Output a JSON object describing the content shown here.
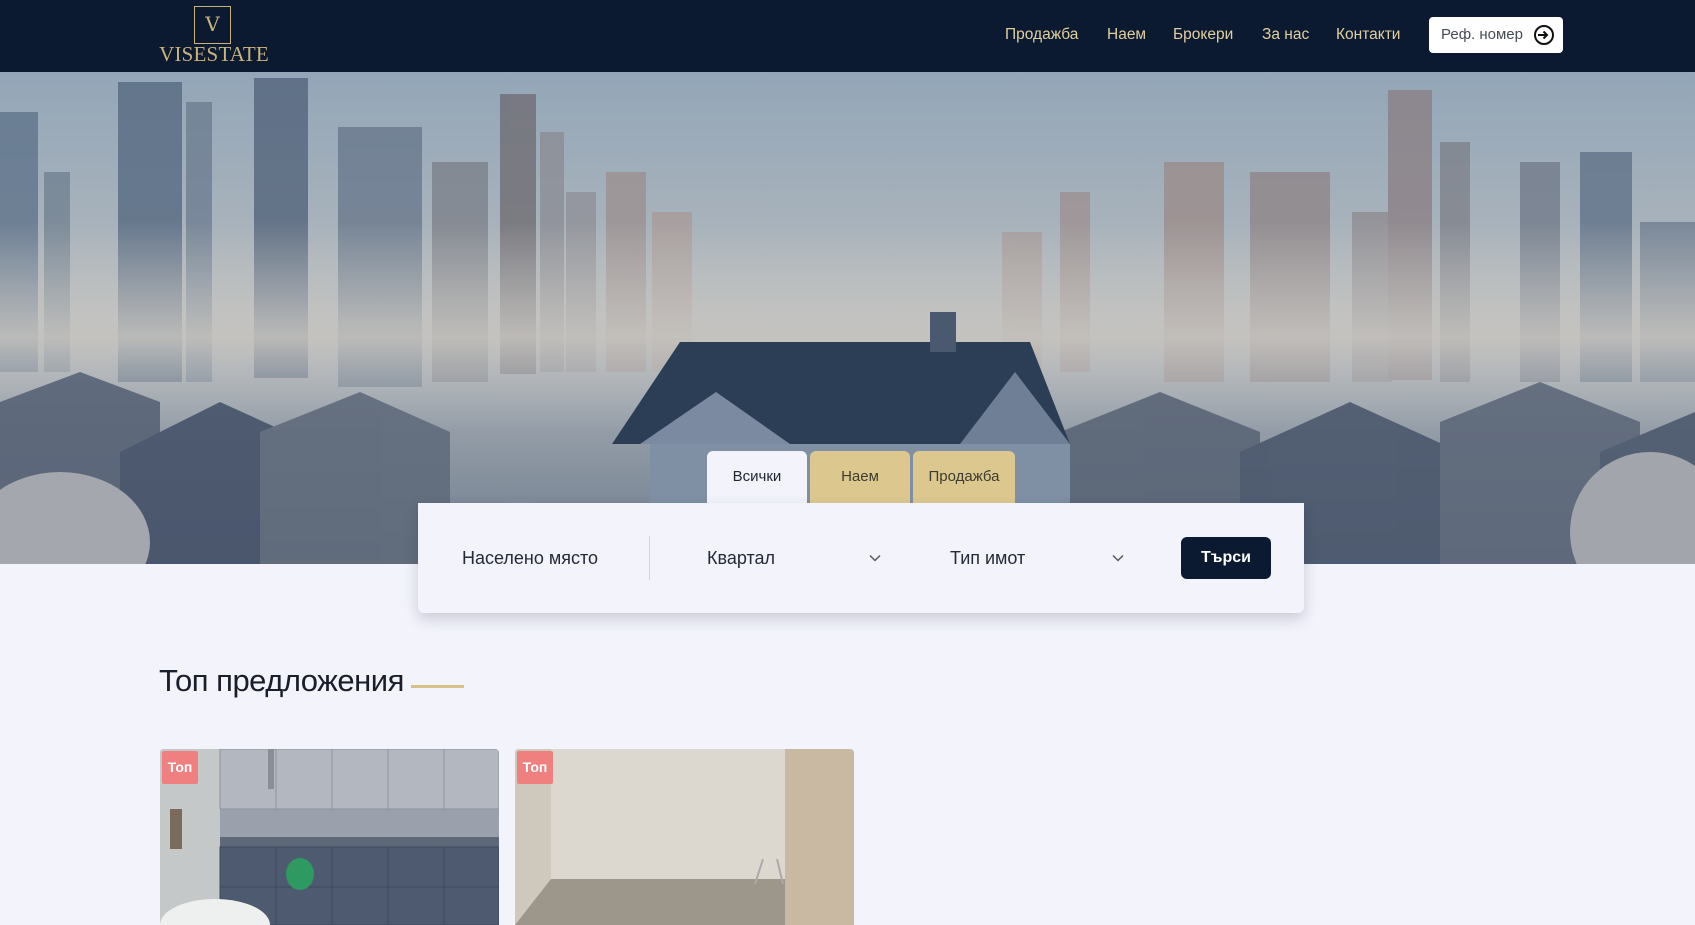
{
  "header": {
    "logo": {
      "letter": "V",
      "wordmark": "VISESTATE"
    },
    "nav": [
      {
        "label": "Продажба"
      },
      {
        "label": "Наем"
      },
      {
        "label": "Брокери"
      },
      {
        "label": "За нас"
      },
      {
        "label": "Контакти"
      }
    ],
    "ref_button": {
      "label": "Реф. номер",
      "icon": "login-icon"
    }
  },
  "search": {
    "tabs": [
      {
        "label": "Всички",
        "active": true
      },
      {
        "label": "Наем",
        "active": false
      },
      {
        "label": "Продажба",
        "active": false
      }
    ],
    "location_placeholder": "Населено място",
    "district_label": "Квартал",
    "type_label": "Тип имот",
    "submit_label": "Търси"
  },
  "offers": {
    "title": "Топ предложения",
    "cards": [
      {
        "badge": "Топ"
      },
      {
        "badge": "Топ"
      }
    ]
  },
  "colors": {
    "header_bg": "#0b1a30",
    "gold": "#dcc88f",
    "badge": "#f07f7f",
    "page_bg": "#f2f3fb"
  }
}
